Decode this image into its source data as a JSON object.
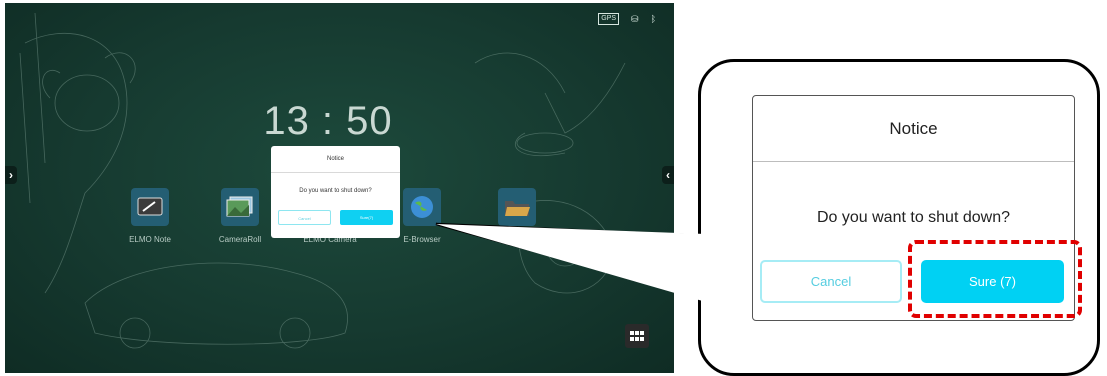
{
  "screen": {
    "clock": "13 : 50",
    "status_icons": [
      {
        "name": "gps-icon",
        "text": "GPS"
      },
      {
        "name": "network-icon",
        "glyph": "⛁"
      },
      {
        "name": "bluetooth-icon",
        "glyph": "ᛒ"
      }
    ],
    "nav_left_glyph": "›",
    "nav_right_glyph": "‹",
    "apps": [
      {
        "label": "ELMO Note",
        "icon": "note-icon"
      },
      {
        "label": "CameraRoll",
        "icon": "gallery-icon"
      },
      {
        "label": "ELMO Camera",
        "icon": "camera-icon"
      },
      {
        "label": "E-Browser",
        "icon": "globe-icon"
      },
      {
        "label": "",
        "icon": "folder-icon"
      }
    ],
    "dialog": {
      "title": "Notice",
      "message": "Do you want to shut down?",
      "cancel": "Cancel",
      "sure": "Sure(7)"
    }
  },
  "zoom": {
    "title": "Notice",
    "message": "Do you want to shut down?",
    "cancel": "Cancel",
    "sure": "Sure (7)"
  },
  "colors": {
    "accent": "#00d1f3",
    "highlight": "#e00000",
    "background": "#163a30"
  }
}
